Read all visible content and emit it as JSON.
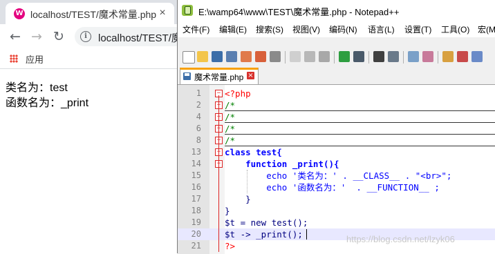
{
  "browser": {
    "tab_title": "localhost/TEST/魔术常量.php",
    "tab_close": "×",
    "url": "localhost/TEST/魔",
    "bookmark_apps": "应用",
    "content_lines": [
      "类名为：test",
      "函数名为：_print"
    ]
  },
  "notepad": {
    "title": "E:\\wamp64\\www\\TEST\\魔术常量.php - Notepad++",
    "menu": [
      "文件(F)",
      "编辑(E)",
      "搜索(S)",
      "视图(V)",
      "编码(N)",
      "语言(L)",
      "设置(T)",
      "工具(O)",
      "宏(M"
    ],
    "tab_label": "魔术常量.php",
    "tab_close": "×",
    "lines": [
      {
        "num": "1",
        "text": "<?php"
      },
      {
        "num": "2",
        "text": "/*"
      },
      {
        "num": "4",
        "text": "/*"
      },
      {
        "num": "6",
        "text": "/*"
      },
      {
        "num": "8",
        "text": "/*"
      },
      {
        "num": "13",
        "text": "class test{"
      },
      {
        "num": "14",
        "text": "    function _print(){"
      },
      {
        "num": "15",
        "text": "        echo '类名为：' . __CLASS__ . \"<br>\";"
      },
      {
        "num": "16",
        "text": "        echo '函数名为：'  . __FUNCTION__ ;"
      },
      {
        "num": "17",
        "text": "    }"
      },
      {
        "num": "18",
        "text": "}"
      },
      {
        "num": "19",
        "text": "$t = new test();"
      },
      {
        "num": "20",
        "text": "$t -> _print();"
      },
      {
        "num": "21",
        "text": "?>"
      }
    ]
  },
  "watermark": "https://blog.csdn.net/lzyk06",
  "colors": {
    "keyword": "#0000ff",
    "string": "#808080",
    "php_tag": "#ff0000",
    "comment": "#008000",
    "tab_accent": "#f8a000",
    "favicon": "#e4007f"
  }
}
